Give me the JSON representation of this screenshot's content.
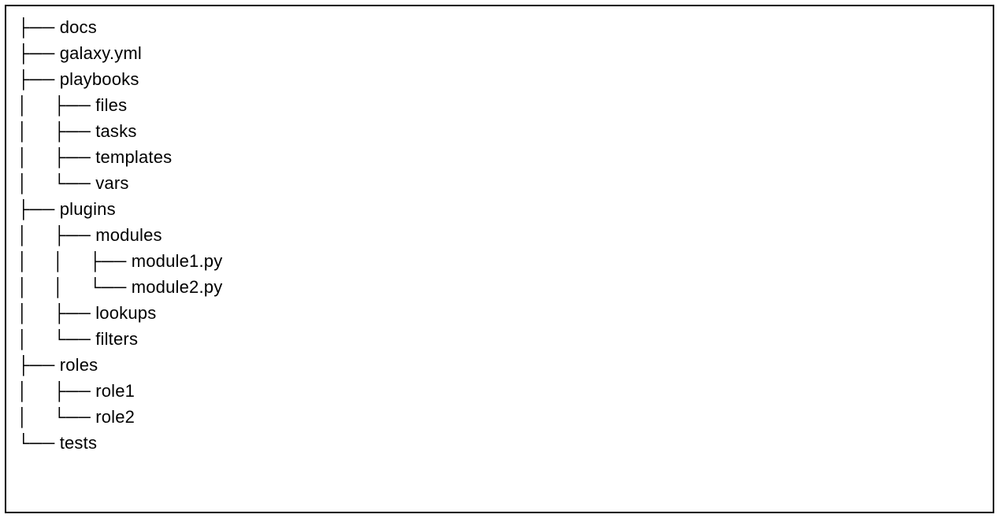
{
  "tree": [
    {
      "prefix": "├── ",
      "label": "docs"
    },
    {
      "prefix": "├── ",
      "label": "galaxy.yml"
    },
    {
      "prefix": "├── ",
      "label": "playbooks"
    },
    {
      "prefix": "│     ├── ",
      "label": "files"
    },
    {
      "prefix": "│     ├── ",
      "label": "tasks"
    },
    {
      "prefix": "│     ├── ",
      "label": "templates"
    },
    {
      "prefix": "│     └── ",
      "label": "vars"
    },
    {
      "prefix": "├── ",
      "label": "plugins"
    },
    {
      "prefix": "│     ├── ",
      "label": "modules"
    },
    {
      "prefix": "│     │     ├── ",
      "label": "module1.py"
    },
    {
      "prefix": "│     │     └── ",
      "label": "module2.py"
    },
    {
      "prefix": "│     ├── ",
      "label": "lookups"
    },
    {
      "prefix": "│     └── ",
      "label": "filters"
    },
    {
      "prefix": "├── ",
      "label": "roles"
    },
    {
      "prefix": "│     ├── ",
      "label": "role1"
    },
    {
      "prefix": "│     └── ",
      "label": "role2"
    },
    {
      "prefix": "└── ",
      "label": "tests"
    }
  ]
}
